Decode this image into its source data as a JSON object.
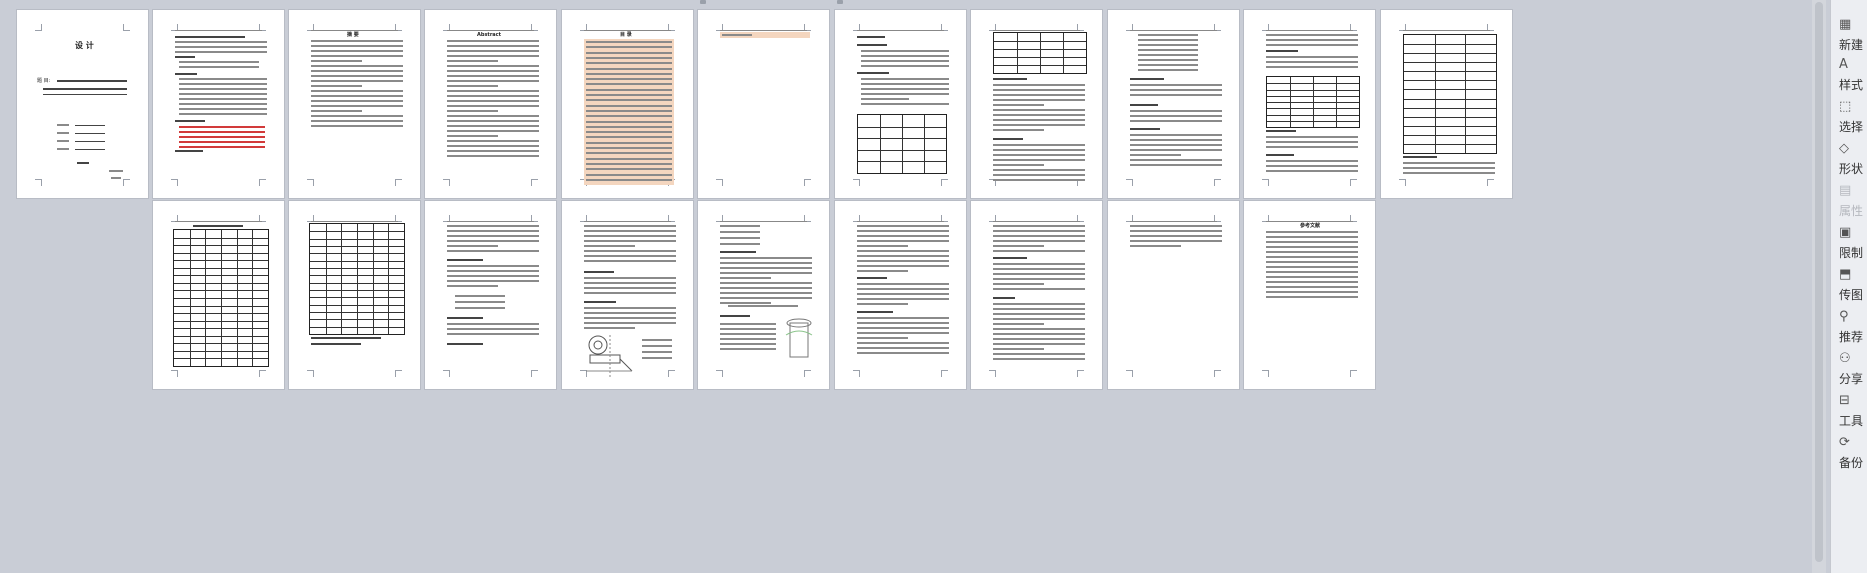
{
  "document": {
    "cover_title": "设 计",
    "cover_subject_label": "题  目:",
    "toc_heading": "目  录",
    "abstract_cn_heading": "摘  要",
    "abstract_en_heading": "Abstract",
    "references_heading": "参考文献"
  },
  "sidebar": {
    "items": [
      {
        "label": "新建",
        "icon": "new-doc-icon",
        "glyph": "▦"
      },
      {
        "label": "样式",
        "icon": "style-icon",
        "glyph": "A"
      },
      {
        "label": "选择",
        "icon": "select-icon",
        "glyph": "⬚"
      },
      {
        "label": "形状",
        "icon": "shape-icon",
        "glyph": "◇"
      },
      {
        "label": "属性",
        "icon": "property-icon",
        "glyph": "▤"
      },
      {
        "label": "限制",
        "icon": "restrict-icon",
        "glyph": "▣"
      },
      {
        "label": "传图",
        "icon": "upload-image-icon",
        "glyph": "⬒"
      },
      {
        "label": "推荐",
        "icon": "recommend-icon",
        "glyph": "⚲"
      },
      {
        "label": "分享",
        "icon": "share-icon",
        "glyph": "⚇"
      },
      {
        "label": "工具",
        "icon": "toolbox-icon",
        "glyph": "⊟"
      },
      {
        "label": "备份",
        "icon": "backup-icon",
        "glyph": "⟳"
      }
    ]
  }
}
